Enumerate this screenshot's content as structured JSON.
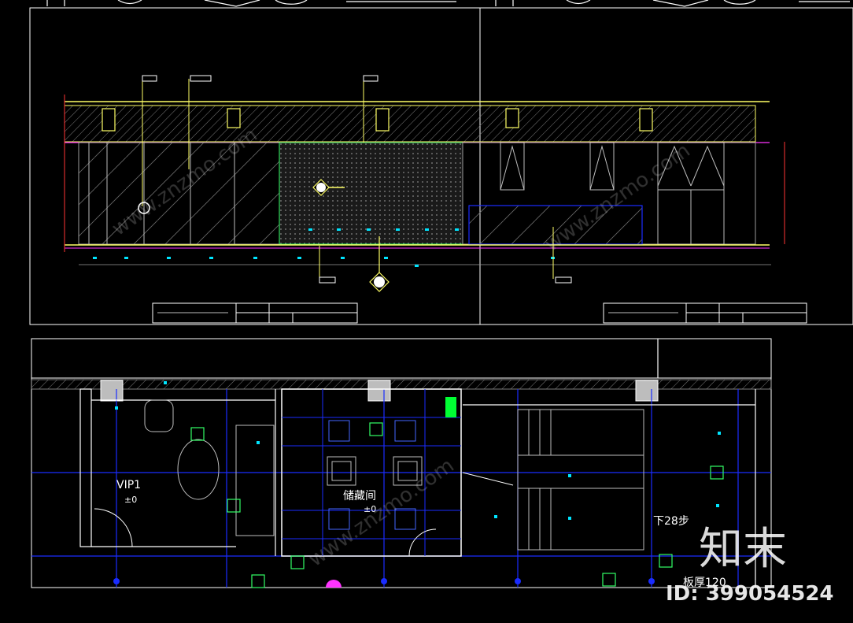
{
  "colors": {
    "background": "#000000",
    "frame": "#ffffff",
    "yellow": "#ffff66",
    "magenta": "#ff33ff",
    "cyan": "#00e5ff",
    "blue": "#1a2cff",
    "green": "#33ff66",
    "grey": "#9a9a9a",
    "brightGreen": "#00ff33"
  },
  "plan": {
    "room_vip1": {
      "name": "VIP1",
      "level": "±0"
    },
    "room_storage": {
      "name": "储藏间",
      "level": "±0"
    },
    "stair_label": "下28步",
    "slab_label": "板厚120"
  },
  "watermark": {
    "logo_text": "知末",
    "id_text": "ID: 399054524",
    "site_text": "www.znzmo.com"
  }
}
